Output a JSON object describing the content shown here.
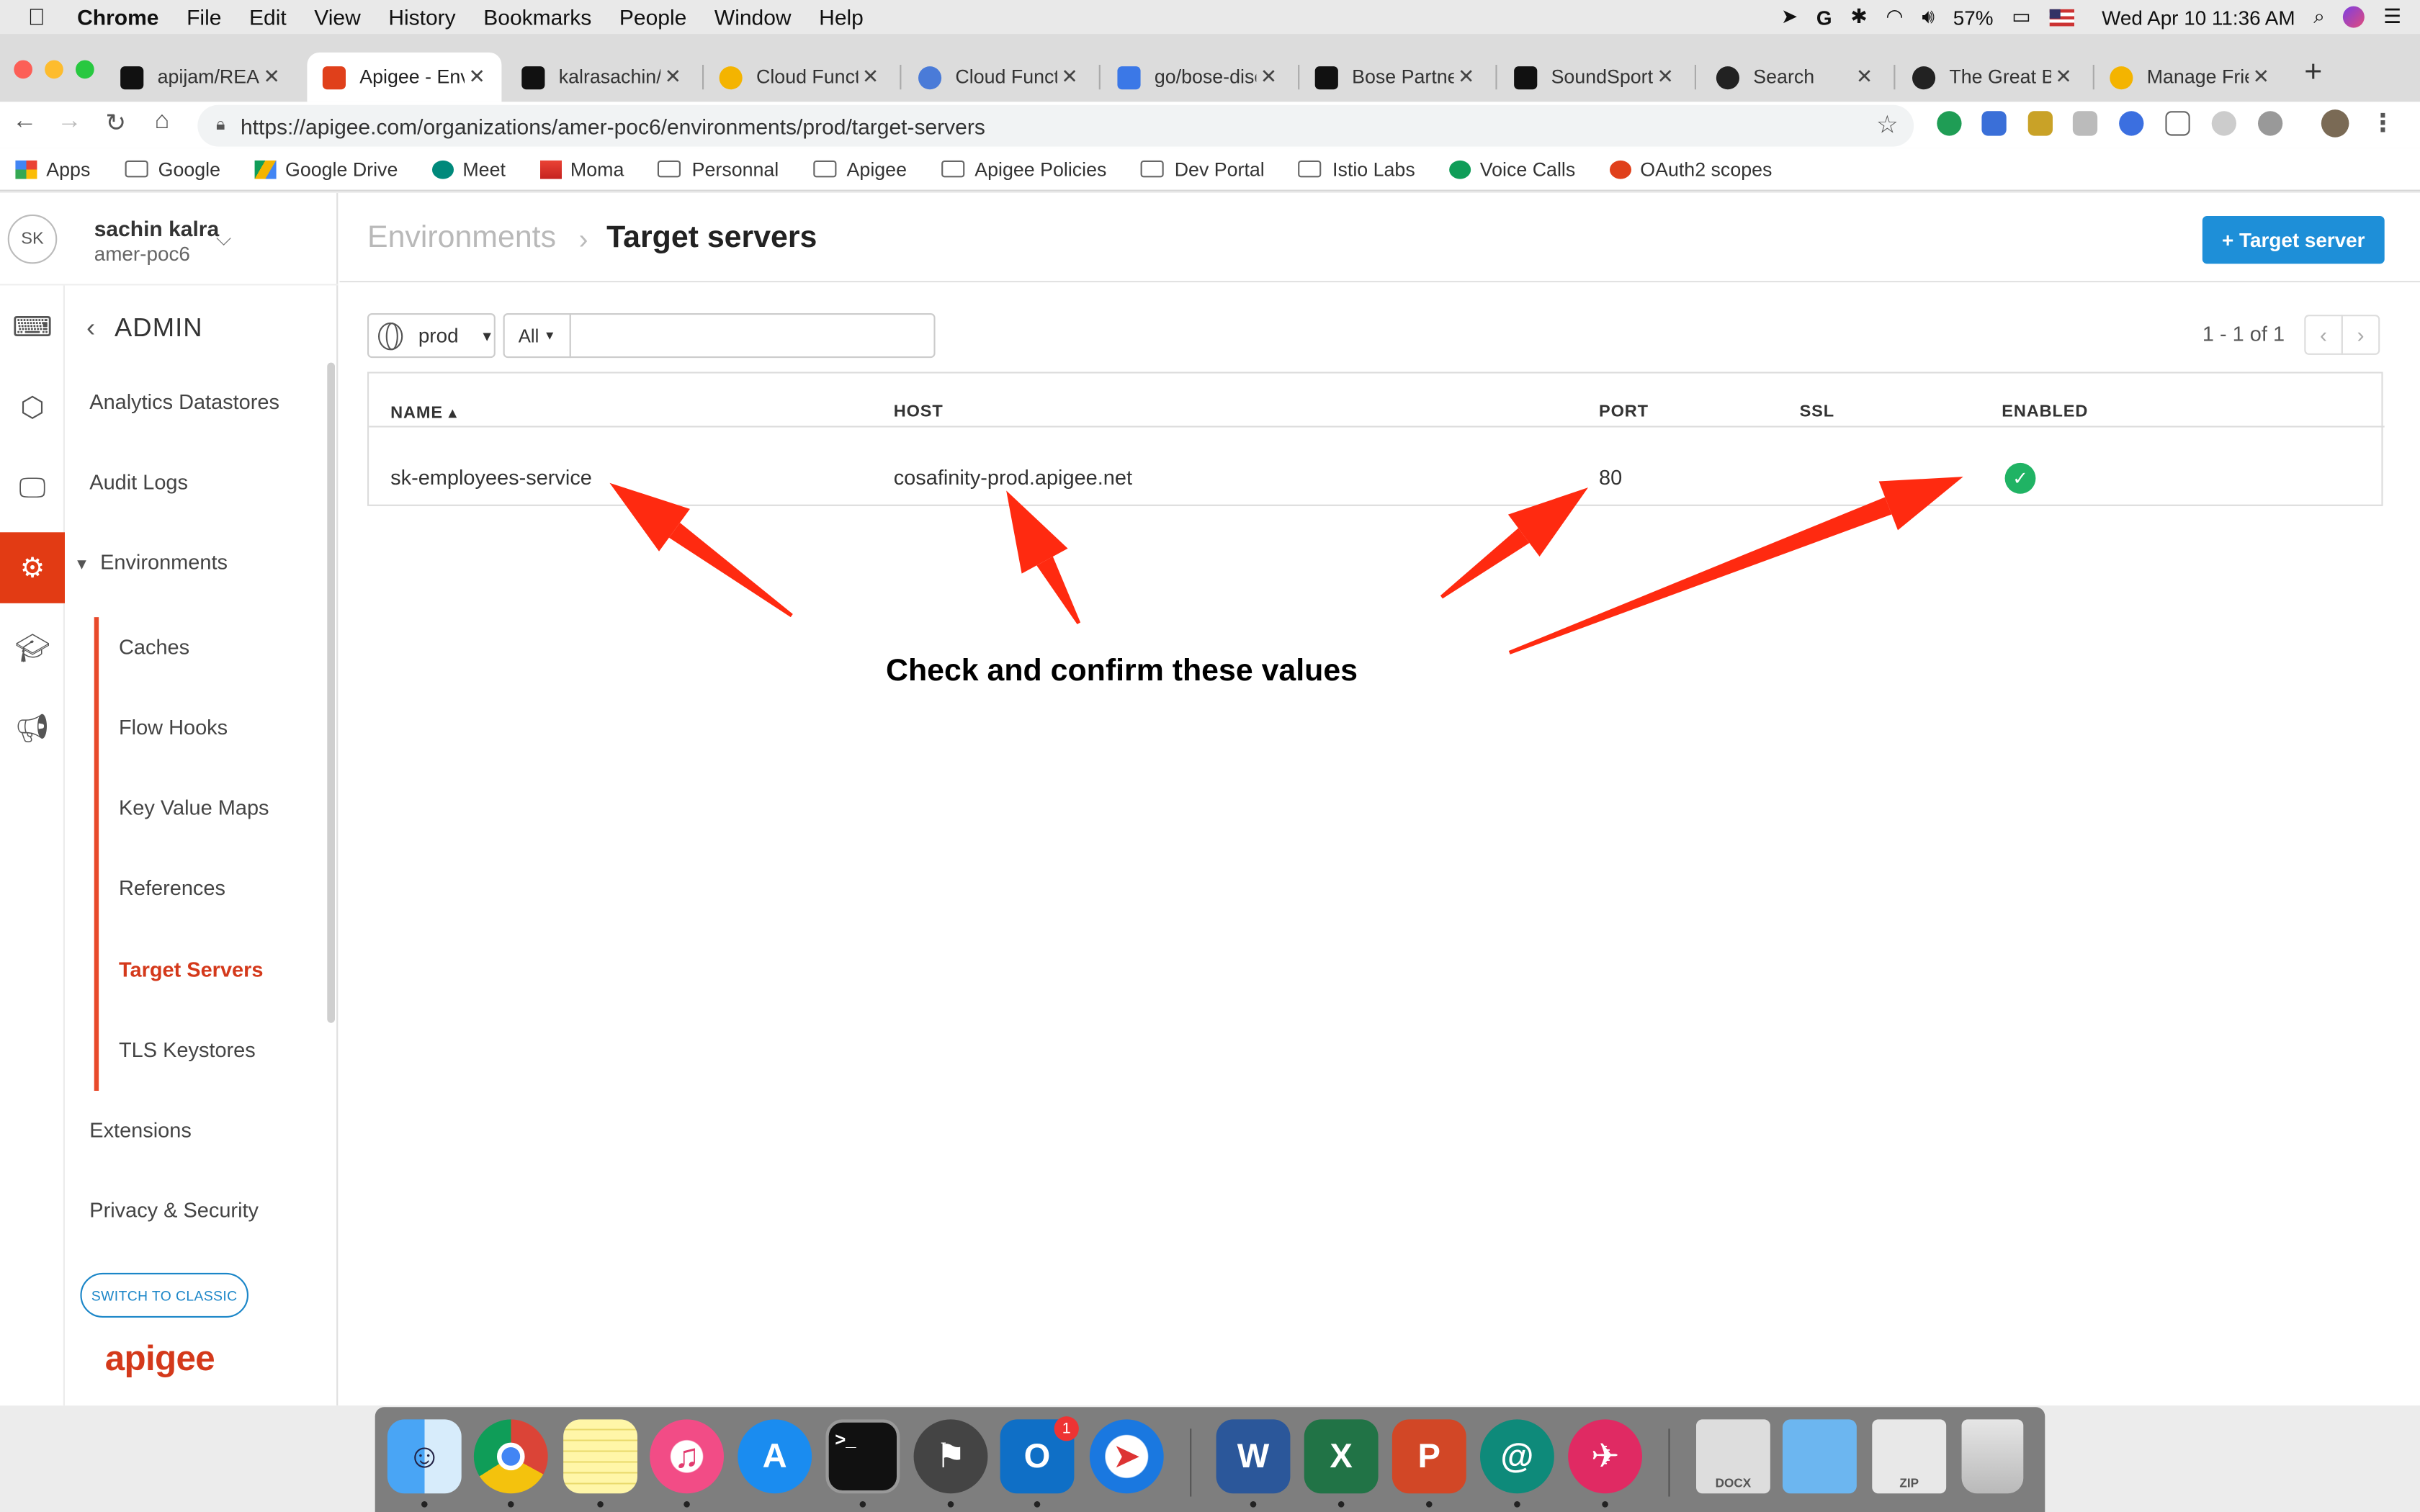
{
  "menubar": {
    "app": "Chrome",
    "items": [
      "File",
      "Edit",
      "View",
      "History",
      "Bookmarks",
      "People",
      "Window",
      "Help"
    ],
    "battery": "57%",
    "datetime": "Wed Apr 10  11:36 AM"
  },
  "tabs": [
    {
      "title": "apijam/READ",
      "icon": "github-icon",
      "color": "#111111"
    },
    {
      "title": "Apigee - Env",
      "icon": "apigee-icon",
      "color": "#e0401b",
      "active": true
    },
    {
      "title": "kalrasachin/a",
      "icon": "github-icon",
      "color": "#111111"
    },
    {
      "title": "Cloud Functi",
      "icon": "cloud-functions-icon",
      "color": "#f4b400"
    },
    {
      "title": "Cloud Functi",
      "icon": "cloud-functions-code-icon",
      "color": "#4a7bd8"
    },
    {
      "title": "go/bose-disc",
      "icon": "google-docs-icon",
      "color": "#3b78e7"
    },
    {
      "title": "Bose Partner",
      "icon": "bose-icon",
      "color": "#111111"
    },
    {
      "title": "SoundSport",
      "icon": "bose-icon",
      "color": "#111111"
    },
    {
      "title": "Search",
      "icon": "spotify-icon",
      "color": "#222222"
    },
    {
      "title": "The Great Bl",
      "icon": "spotify-icon",
      "color": "#222222"
    },
    {
      "title": "Manage Frie",
      "icon": "cloud-functions-icon",
      "color": "#f4b400"
    }
  ],
  "address": {
    "url": "https://apigee.com/organizations/amer-poc6/environments/prod/target-servers"
  },
  "bookmarks": [
    {
      "label": "Apps",
      "icon": "apps-grid-icon"
    },
    {
      "label": "Google",
      "icon": "folder-icon"
    },
    {
      "label": "Google Drive",
      "icon": "google-drive-icon"
    },
    {
      "label": "Meet",
      "icon": "meet-icon"
    },
    {
      "label": "Moma",
      "icon": "gmail-icon"
    },
    {
      "label": "Personnal",
      "icon": "folder-icon"
    },
    {
      "label": "Apigee",
      "icon": "folder-icon"
    },
    {
      "label": "Apigee Policies",
      "icon": "folder-icon"
    },
    {
      "label": "Dev Portal",
      "icon": "folder-icon"
    },
    {
      "label": "Istio Labs",
      "icon": "folder-icon"
    },
    {
      "label": "Voice Calls",
      "icon": "hangouts-icon"
    },
    {
      "label": "OAuth2 scopes",
      "icon": "apigee-icon"
    }
  ],
  "user": {
    "initials": "SK",
    "name": "sachin kalra",
    "org": "amer-poc6"
  },
  "sidebar": {
    "section": "ADMIN",
    "items": [
      {
        "label": "Analytics Datastores"
      },
      {
        "label": "Audit Logs"
      },
      {
        "label": "Environments"
      },
      {
        "label": "Caches"
      },
      {
        "label": "Flow Hooks"
      },
      {
        "label": "Key Value Maps"
      },
      {
        "label": "References"
      },
      {
        "label": "Target Servers",
        "selected": true
      },
      {
        "label": "TLS Keystores"
      },
      {
        "label": "Extensions"
      },
      {
        "label": "Privacy & Security"
      }
    ],
    "classic_button": "SWITCH TO CLASSIC",
    "logo": "apigee"
  },
  "header": {
    "breadcrumb": "Environments",
    "title": "Target servers",
    "add_button": "+ Target server"
  },
  "filters": {
    "environment": "prod",
    "filter": "All",
    "search_value": ""
  },
  "pagination": {
    "text": "1 - 1 of 1"
  },
  "table": {
    "columns": [
      "NAME ▴",
      "HOST",
      "PORT",
      "SSL",
      "ENABLED"
    ],
    "rows": [
      {
        "name": "sk-employees-service",
        "host": "cosafinity-prod.apigee.net",
        "port": "80",
        "ssl": "",
        "enabled": true
      }
    ]
  },
  "annotation": {
    "text": "Check and confirm these values",
    "arrow_color": "#ff2a10"
  },
  "dock": {
    "apps": [
      "Finder",
      "Chrome",
      "Notes",
      "iTunes",
      "App Store",
      "Terminal",
      "Migration",
      "Outlook",
      "Safari",
      "Word",
      "Excel",
      "PowerPoint",
      "Mail At",
      "Airmail",
      "Documents",
      "Folder",
      "Archive",
      "Trash"
    ],
    "outlook_badge": "1",
    "docx_label": "DOCX",
    "zip_label": "ZIP"
  }
}
